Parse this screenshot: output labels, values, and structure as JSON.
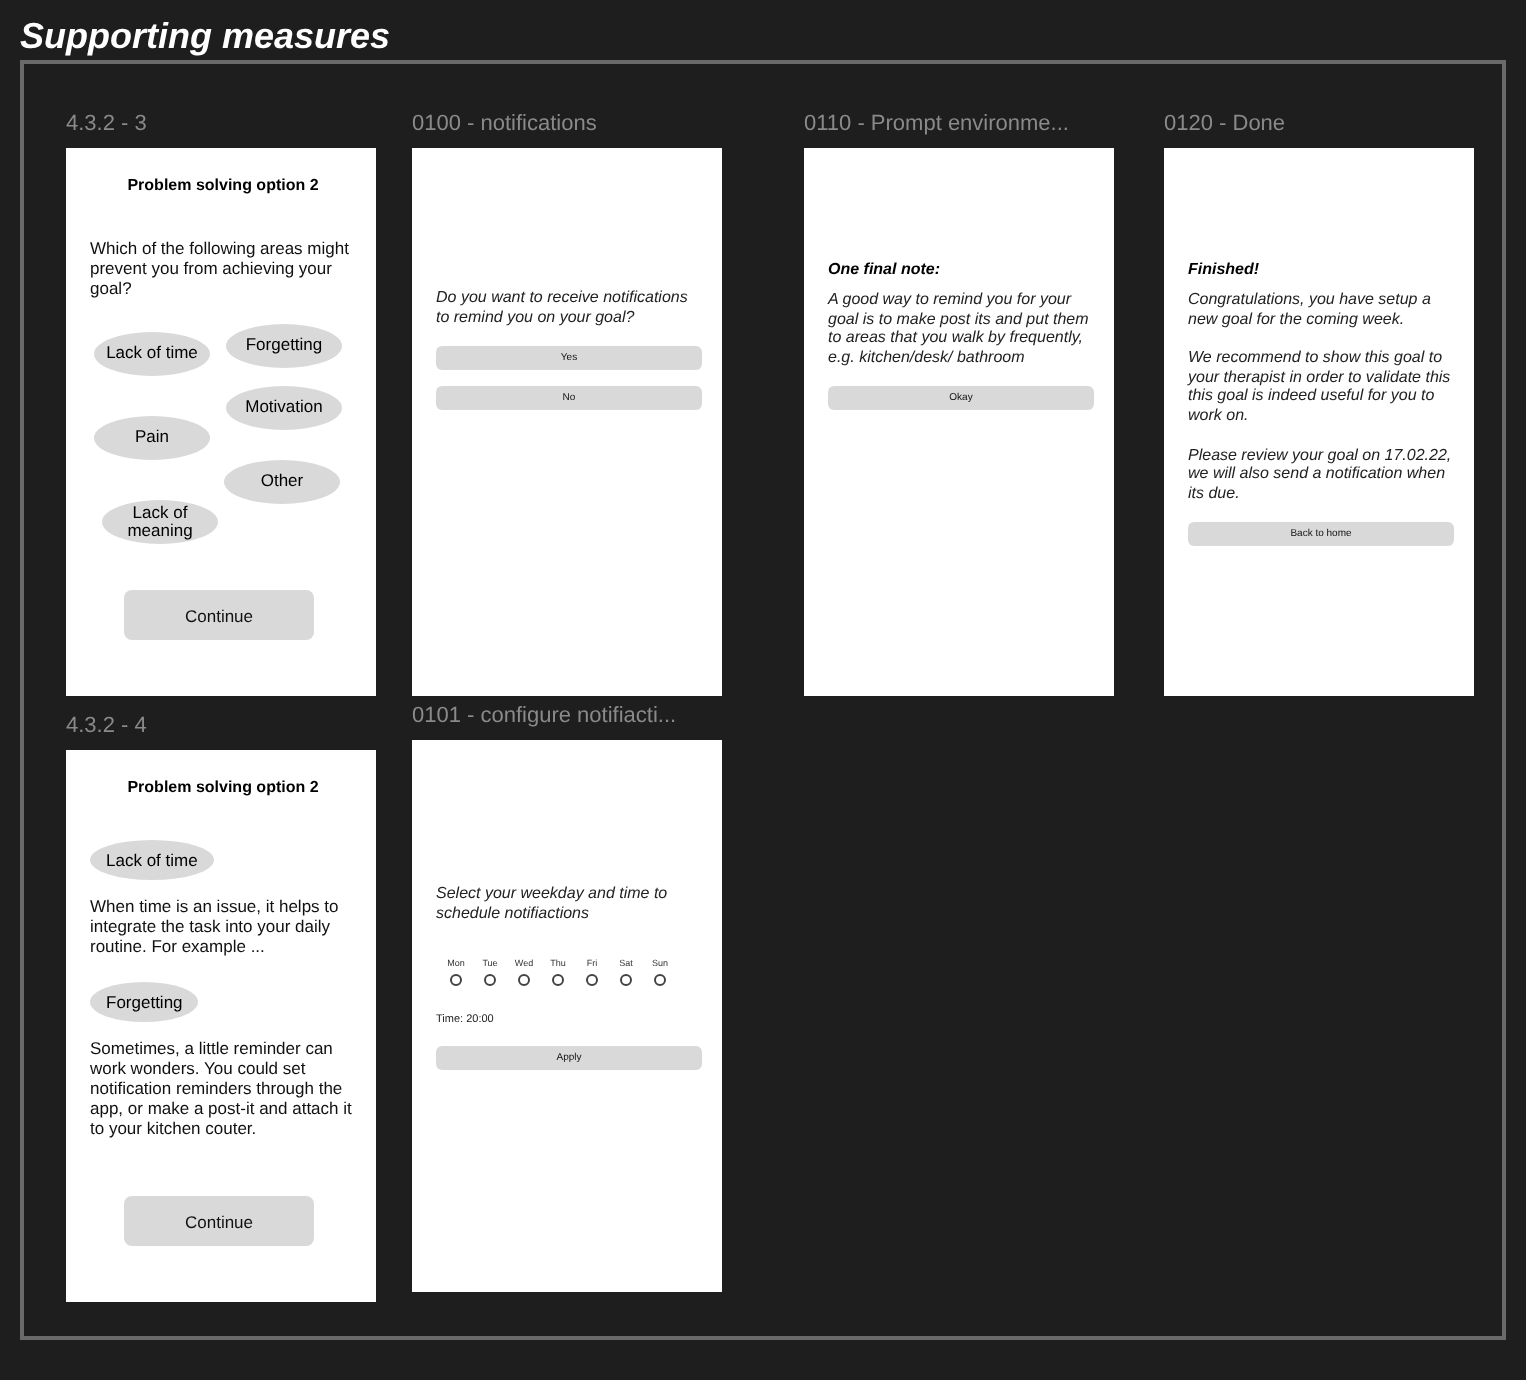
{
  "title": "Supporting measures",
  "frames": [
    {
      "label": "4.3.2 - 3",
      "blocks": [
        {
          "kind": "title",
          "text": "Problem solving option 2"
        },
        {
          "kind": "paragraph",
          "text": "Which of the following areas might prevent you from achieving your goal?"
        },
        {
          "kind": "chip_cloud",
          "items": [
            "Lack of time",
            "Forgetting",
            "Motivation",
            "Pain",
            "Other",
            "Lack of meaning"
          ]
        },
        {
          "kind": "big_button",
          "text": "Continue"
        }
      ]
    },
    {
      "label": "0100 - notifications",
      "blocks": [
        {
          "kind": "note",
          "text": "Do you want to receive notifications to remind you on your goal?"
        },
        {
          "kind": "bar_button",
          "text": "Yes"
        },
        {
          "kind": "bar_button",
          "text": "No"
        }
      ]
    },
    {
      "label": "0110 - Prompt environme...",
      "blocks": [
        {
          "kind": "note_title",
          "text": "One final note:"
        },
        {
          "kind": "note",
          "text": "A good way to remind you for your goal is to make post its and put them to areas that you walk by frequently, e.g. kitchen/desk/ bathroom"
        },
        {
          "kind": "bar_button",
          "text": "Okay"
        }
      ]
    },
    {
      "label": "0120 - Done",
      "blocks": [
        {
          "kind": "note_title",
          "text": "Finished!"
        },
        {
          "kind": "note",
          "text": "Congratulations, you have setup a new goal for the coming week."
        },
        {
          "kind": "note",
          "text": "We recommend to show this goal to your therapist in order to validate this this goal is indeed useful for you to work on."
        },
        {
          "kind": "note",
          "text": "Please review your goal on 17.02.22, we will also send a notification when its due."
        },
        {
          "kind": "bar_button",
          "text": "Back to home"
        }
      ]
    },
    {
      "label": "4.3.2 - 4",
      "blocks": [
        {
          "kind": "title",
          "text": "Problem solving option 2"
        },
        {
          "kind": "chip",
          "text": "Lack of time"
        },
        {
          "kind": "paragraph",
          "text": "When time is an issue, it helps to integrate the task into your daily routine. For example ..."
        },
        {
          "kind": "chip",
          "text": "Forgetting"
        },
        {
          "kind": "paragraph",
          "text": "Sometimes, a little reminder can work wonders. You could set notification reminders through the app, or make a post-it and attach it to your kitchen couter."
        },
        {
          "kind": "big_button",
          "text": "Continue"
        }
      ]
    },
    {
      "label": "0101 - configure notifiacti...",
      "blocks": [
        {
          "kind": "note",
          "text": "Select your weekday and time to schedule notifiactions"
        },
        {
          "kind": "weekdays",
          "days": [
            {
              "label": "Mon",
              "selected": false
            },
            {
              "label": "Tue",
              "selected": false
            },
            {
              "label": "Wed",
              "selected": false
            },
            {
              "label": "Thu",
              "selected": false
            },
            {
              "label": "Fri",
              "selected": false
            },
            {
              "label": "Sat",
              "selected": false
            },
            {
              "label": "Sun",
              "selected": false
            }
          ]
        },
        {
          "kind": "small_text",
          "text": "Time: 20:00"
        },
        {
          "kind": "bar_button",
          "text": "Apply"
        }
      ]
    }
  ]
}
